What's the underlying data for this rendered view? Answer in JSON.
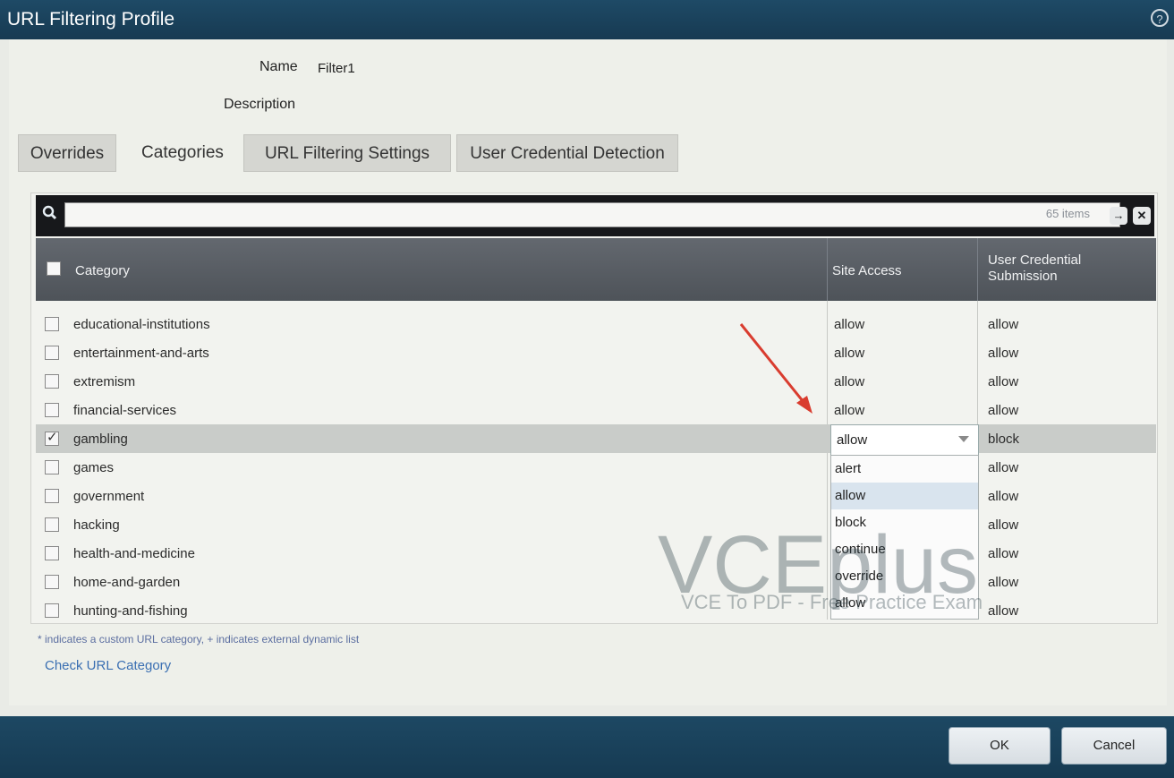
{
  "dialog": {
    "title": "URL Filtering Profile",
    "help_icon": "help-icon"
  },
  "form": {
    "name_label": "Name",
    "name_value": "Filter1",
    "description_label": "Description",
    "description_value": ""
  },
  "tabs": [
    {
      "label": "Overrides",
      "active": false
    },
    {
      "label": "Categories",
      "active": true
    },
    {
      "label": "URL Filtering Settings",
      "active": false
    },
    {
      "label": "User Credential Detection",
      "active": false
    }
  ],
  "search": {
    "placeholder": "",
    "count_text": "65 items"
  },
  "table": {
    "headers": {
      "category": "Category",
      "site_access": "Site Access",
      "credential": "User Credential Submission"
    },
    "rows": [
      {
        "name": "educational-institutions",
        "site_access": "allow",
        "credential": "allow",
        "checked": false
      },
      {
        "name": "entertainment-and-arts",
        "site_access": "allow",
        "credential": "allow",
        "checked": false
      },
      {
        "name": "extremism",
        "site_access": "allow",
        "credential": "allow",
        "checked": false
      },
      {
        "name": "financial-services",
        "site_access": "allow",
        "credential": "allow",
        "checked": false
      },
      {
        "name": "gambling",
        "site_access": "allow",
        "credential": "block",
        "checked": true
      },
      {
        "name": "games",
        "site_access": "",
        "credential": "allow",
        "checked": false
      },
      {
        "name": "government",
        "site_access": "",
        "credential": "allow",
        "checked": false
      },
      {
        "name": "hacking",
        "site_access": "",
        "credential": "allow",
        "checked": false
      },
      {
        "name": "health-and-medicine",
        "site_access": "",
        "credential": "allow",
        "checked": false
      },
      {
        "name": "home-and-garden",
        "site_access": "",
        "credential": "allow",
        "checked": false
      },
      {
        "name": "hunting-and-fishing",
        "site_access": "",
        "credential": "allow",
        "checked": false
      }
    ],
    "dropdown": {
      "current_value": "allow",
      "options": [
        "alert",
        "allow",
        "block",
        "continue",
        "override",
        "allow"
      ]
    }
  },
  "footer_note": "* indicates a custom URL category, + indicates external dynamic list",
  "check_link": "Check URL Category",
  "buttons": {
    "ok": "OK",
    "cancel": "Cancel"
  },
  "watermark": {
    "main": "VCEplus",
    "sub": "VCE To PDF - Free Practice Exam"
  },
  "colors": {
    "titlebar": "#1b4460",
    "header": "#575c62",
    "accent_link": "#3a6fb2",
    "arrow": "#d93c2f"
  }
}
